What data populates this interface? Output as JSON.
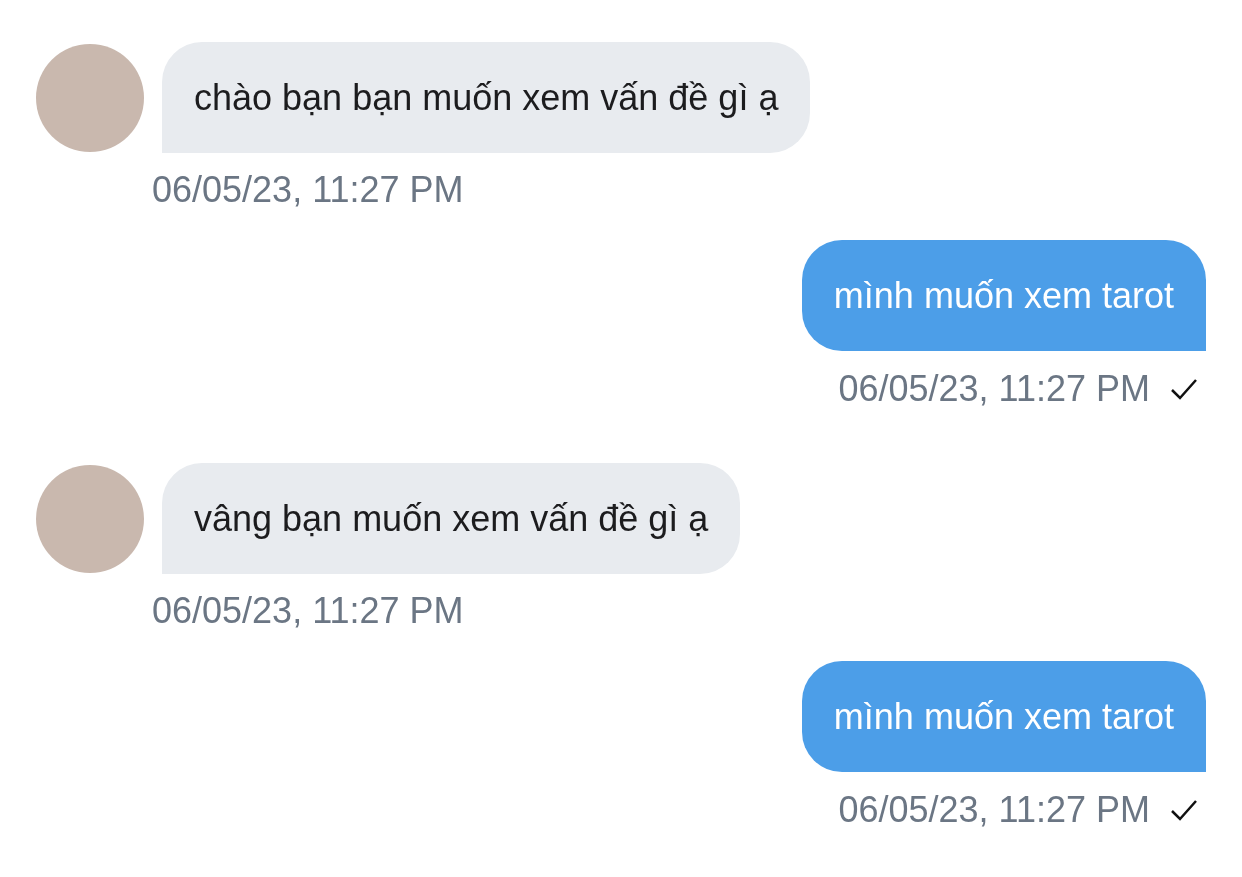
{
  "messages": [
    {
      "kind": "incoming",
      "text": "chào bạn bạn muốn xem vấn đề gì ạ",
      "time": "06/05/23, 11:27 PM"
    },
    {
      "kind": "outgoing",
      "text": "mình muốn xem tarot",
      "time": "06/05/23, 11:27 PM",
      "delivered": true
    },
    {
      "kind": "incoming",
      "text": "vâng bạn muốn xem vấn đề gì ạ",
      "time": "06/05/23, 11:27 PM"
    },
    {
      "kind": "outgoing",
      "text": "mình muốn xem tarot",
      "time": "06/05/23, 11:27 PM",
      "delivered": true
    }
  ]
}
